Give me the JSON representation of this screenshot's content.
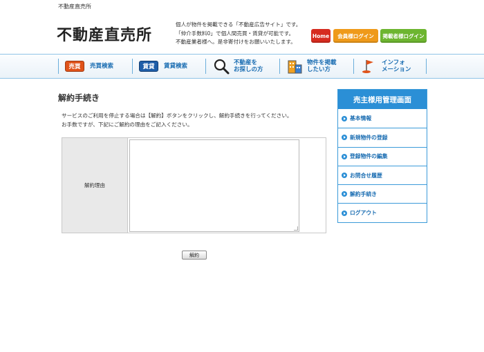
{
  "header": {
    "tagline": "不動産直売所",
    "logo": "不動産直売所",
    "description": [
      "個人が物件を掲載できる「不動産広告サイト」です。",
      "「仲介手数料0」で個人間売買・賃貸が可能です。",
      "不動産業者様へ。是非寄付けをお願いいたします。"
    ],
    "buttons": {
      "home": "Home",
      "member_login": "会員様ログイン",
      "poster_login": "掲載者様ログイン"
    },
    "colors": {
      "home": "#d62b1f",
      "member": "#ef9a1a",
      "poster": "#6db530"
    }
  },
  "nav": {
    "sell_badge": "売買",
    "sell_label": "売買検索",
    "rent_badge": "賃貸",
    "rent_label": "賃貸検索",
    "find_line1": "不動産を",
    "find_line2": "お探しの方",
    "find_icon": "magnifier-icon",
    "post_line1": "物件を掲載",
    "post_line2": "したい方",
    "post_icon": "building-icon",
    "info_line1": "インフォ",
    "info_line2": "メーション",
    "info_icon": "flag-icon"
  },
  "main": {
    "title": "解約手続き",
    "intro_line1": "サービスのご利用を停止する場合は【解約】ボタンをクリックし、解約手続きを行ってください。",
    "intro_line2": "お手数ですが、下記にご解約の理由をご記入ください。",
    "form": {
      "reason_label": "解約理由",
      "reason_value": ""
    },
    "submit_label": "解約"
  },
  "sidebar": {
    "title": "売主様用管理画面",
    "items": [
      {
        "label": "基本情報"
      },
      {
        "label": "新規物件の登録"
      },
      {
        "label": "登録物件の編集"
      },
      {
        "label": "お問合せ履歴"
      },
      {
        "label": "解約手続き"
      },
      {
        "label": "ログアウト"
      }
    ],
    "accent": "#2b8fd6"
  }
}
